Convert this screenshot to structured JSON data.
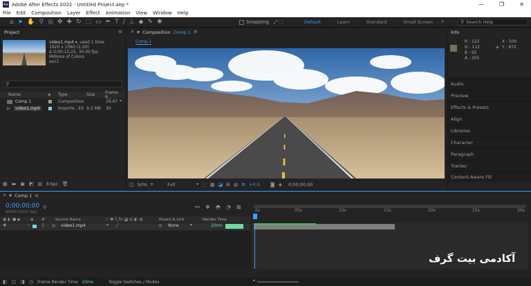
{
  "titlebar": {
    "title": "Adobe After Effects 2022 - Untitled Project.aep *"
  },
  "menu": [
    "File",
    "Edit",
    "Composition",
    "Layer",
    "Effect",
    "Animation",
    "View",
    "Window",
    "Help"
  ],
  "toolbar": {
    "snapping_label": "Snapping",
    "workspaces": [
      "Default",
      "Learn",
      "Standard",
      "Small Screen"
    ],
    "active_workspace": "Default",
    "search_placeholder": "Search Help"
  },
  "project": {
    "tab_label": "Project",
    "item_name": "video1.mp4",
    "used": ", used 1 time",
    "details": [
      "1920 x 1080 (1.00)",
      "Δ 0;00;15;25, 30.00 fps",
      "Millions of Colors",
      "avc1"
    ],
    "search_placeholder": "",
    "columns": {
      "name": "Name",
      "type": "Type",
      "size": "Size",
      "frame_rate": "Frame R..."
    },
    "rows": [
      {
        "name": "Comp 1",
        "type": "Composition",
        "size": "",
        "fps": "29.97"
      },
      {
        "name": "video1.mp4",
        "type": "Importe...EX",
        "size": "9.2 MB",
        "fps": "30"
      }
    ],
    "bpc": "8 bpc"
  },
  "composition": {
    "tab_label": "Composition",
    "tab_comp": "Comp 1",
    "subtab": "Comp 1",
    "zoom": "50%",
    "resolution": "Full",
    "exposure": "+0.0",
    "timecode": "0;00;00;00"
  },
  "info": {
    "tab_label": "Info",
    "r": "R : 122",
    "g": "G : 112",
    "b": "B : 92",
    "a": "A : 255",
    "x": "X : 500",
    "y": "Y : 872",
    "swatch_color": "#7a7058"
  },
  "right_panels": [
    "Audio",
    "Preview",
    "Effects & Presets",
    "Align",
    "Libraries",
    "Character",
    "Paragraph",
    "Tracker",
    "Content-Aware Fill"
  ],
  "timeline": {
    "tab_label": "Comp 1",
    "timecode": "0;00;00;00",
    "fps_sub": "00000 (29.97 fps)",
    "columns": {
      "source": "Source Name",
      "parent": "Parent & Link",
      "render": "Render Time"
    },
    "layer": {
      "num": "1",
      "name": "video1.mp4",
      "parent": "None",
      "render_time": "20ms"
    },
    "ruler": [
      "0s",
      "05s",
      "10s",
      "15s",
      "20s",
      "25s",
      "30s"
    ],
    "frame_render_label": "Frame Render Time",
    "frame_render_value": "20ms",
    "toggle_label": "Toggle Switches / Modes"
  },
  "watermark": "آکادمی بیت گرف"
}
